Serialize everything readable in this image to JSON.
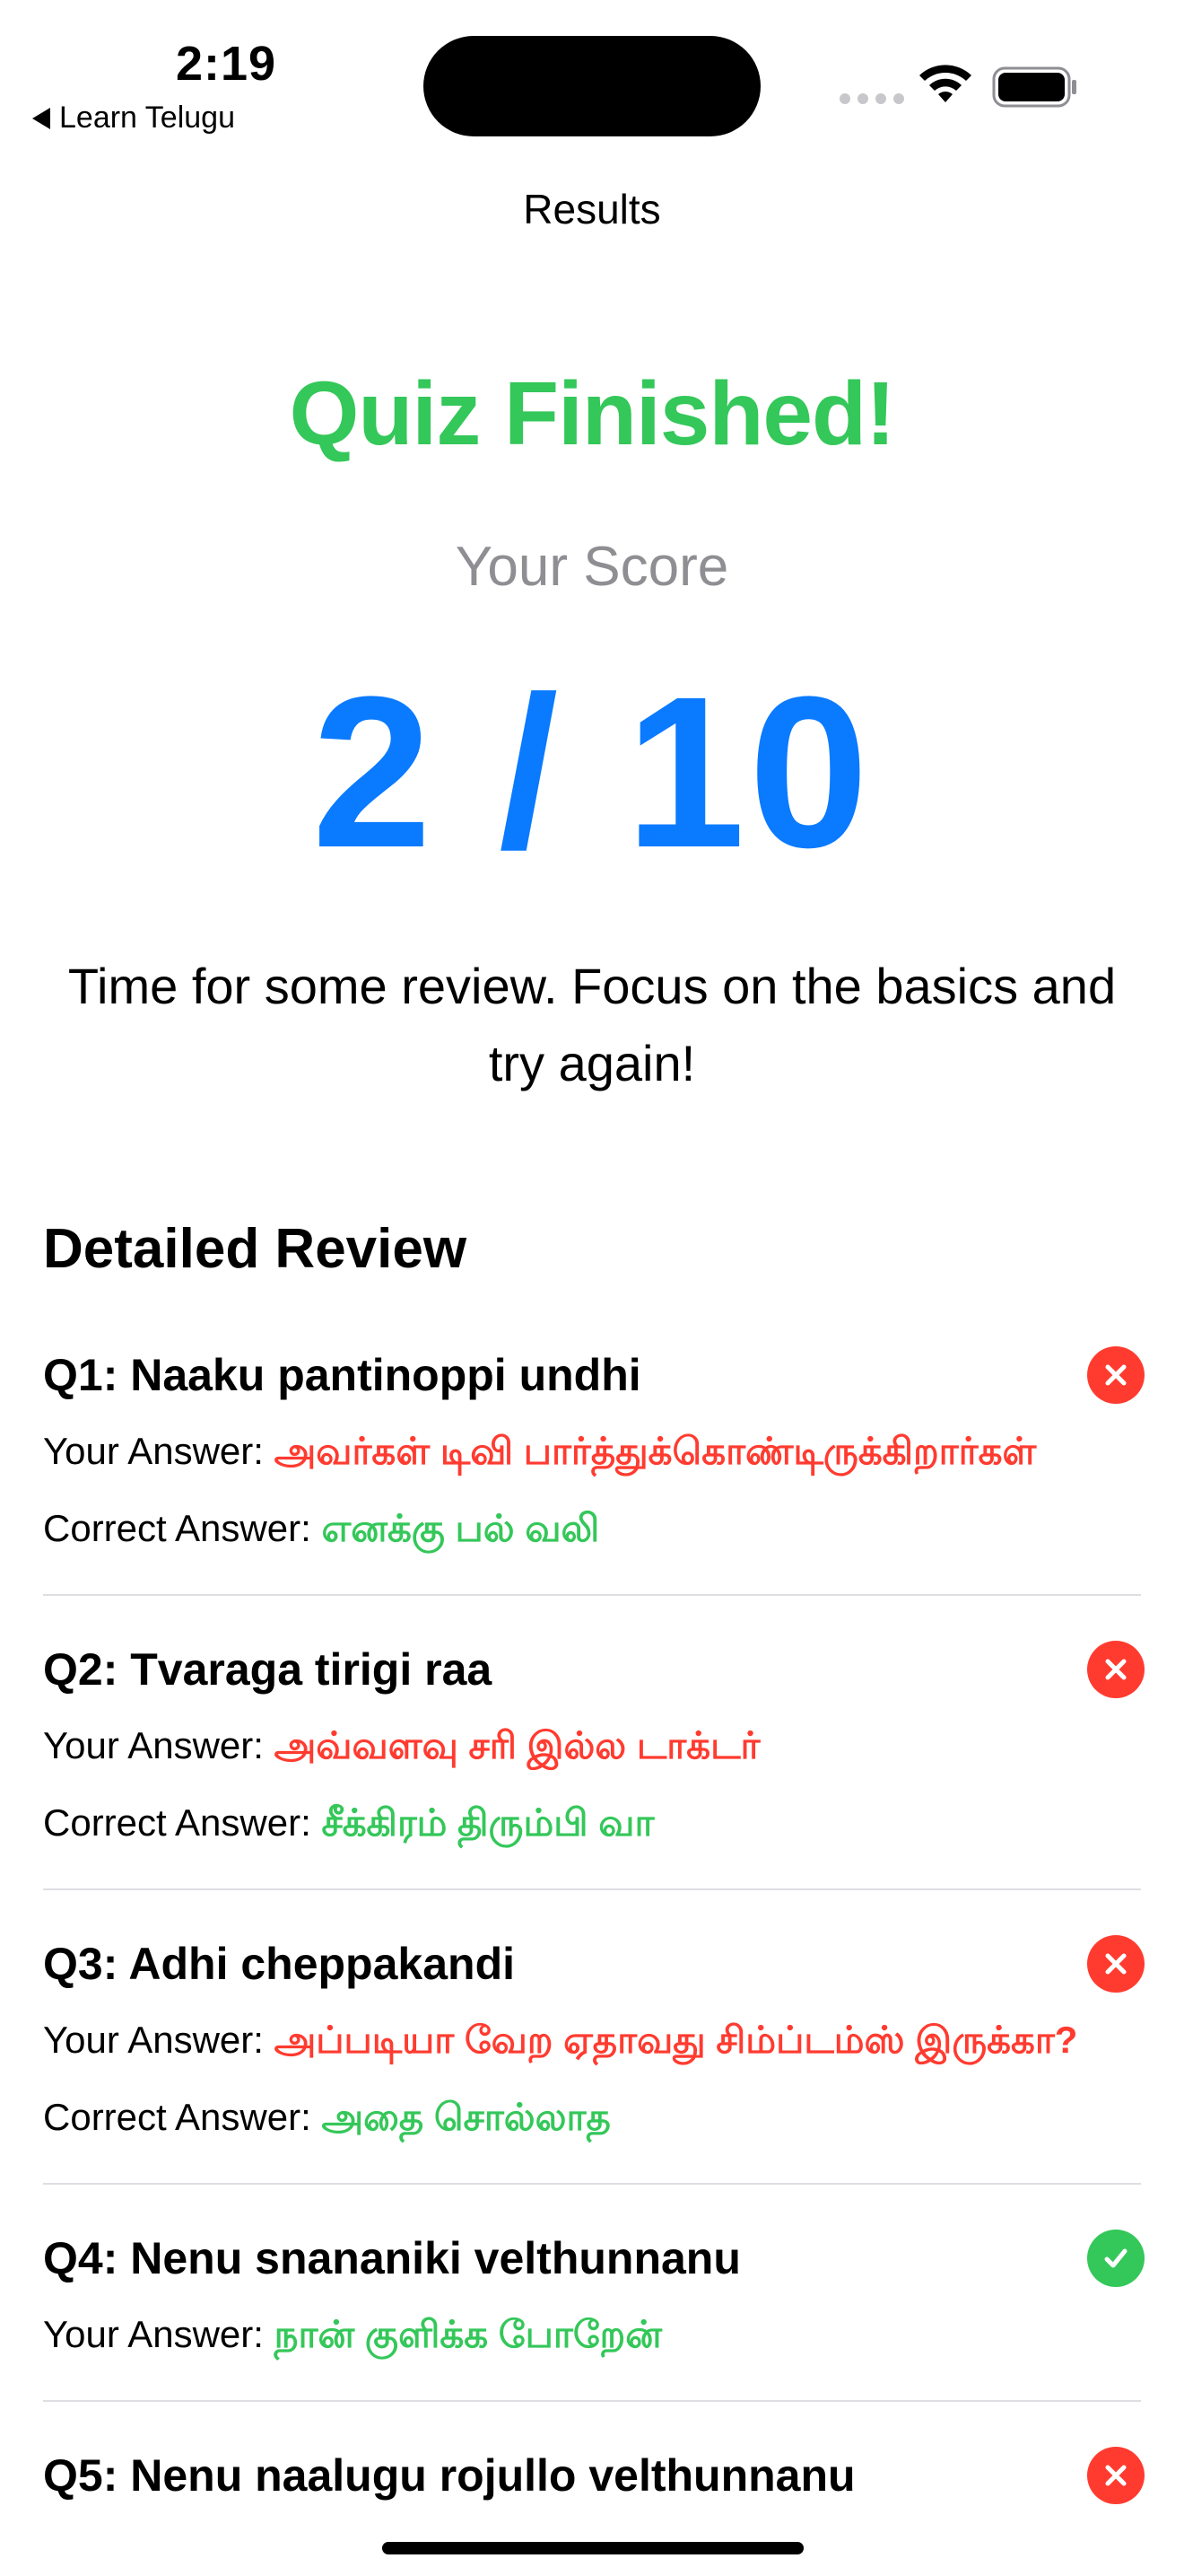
{
  "status_bar": {
    "time": "2:19",
    "back_label": "Learn Telugu"
  },
  "nav": {
    "title": "Results"
  },
  "results": {
    "headline": "Quiz Finished!",
    "score_label": "Your Score",
    "score": "2 / 10",
    "message": "Time for some review. Focus on the basics and try again!"
  },
  "review": {
    "heading": "Detailed Review",
    "your_answer_label": "Your Answer: ",
    "correct_answer_label": "Correct Answer: ",
    "items": [
      {
        "question": "Q1: Naaku pantinoppi undhi",
        "your_answer": "அவர்கள் டிவி பார்த்துக்கொண்டிருக்கிறார்கள்",
        "correct_answer": "எனக்கு பல் வலி",
        "correct": false
      },
      {
        "question": "Q2: Tvaraga tirigi raa",
        "your_answer": "அவ்வளவு சரி இல்ல டாக்டர்",
        "correct_answer": "சீக்கிரம் திரும்பி வா",
        "correct": false
      },
      {
        "question": "Q3: Adhi cheppakandi",
        "your_answer": "அப்படியா வேற ஏதாவது சிம்ப்டம்ஸ் இருக்கா?",
        "correct_answer": "அதை சொல்லாத",
        "correct": false
      },
      {
        "question": "Q4: Nenu snananiki velthunnanu",
        "your_answer": "நான் குளிக்க போறேன்",
        "correct": true
      },
      {
        "question": "Q5: Nenu naalugu rojullo velthunnanu",
        "correct": false
      }
    ]
  },
  "colors": {
    "success": "#34c759",
    "error": "#ff3b30",
    "accent": "#0a7aff",
    "secondary_text": "#8e8e93"
  }
}
